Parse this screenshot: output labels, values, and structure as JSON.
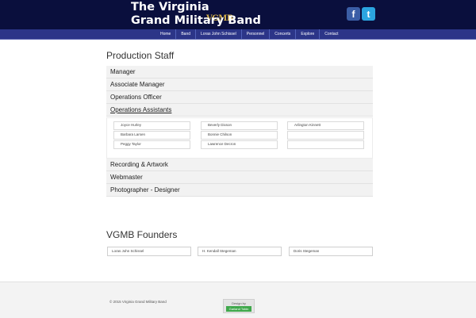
{
  "header": {
    "logo_text": "VGMB",
    "title_line1": "The Virginia",
    "title_line2": "Grand Military Band",
    "facebook_glyph": "f",
    "twitter_glyph": "t"
  },
  "nav": {
    "items": [
      "Home",
      "Band",
      "Loras John Schissel",
      "Personnel",
      "Concerts",
      "Explore",
      "Contact"
    ]
  },
  "production_staff": {
    "title": "Production Staff",
    "roles_top": [
      "Manager",
      "Associate Manager",
      "Operations Officer",
      "Operations Assistants"
    ],
    "assistants": [
      "Joyce Hurley",
      "Beverly Dixson",
      "Arlington Kinnett",
      "Barbara Larsen",
      "Bonnie Chilson",
      "",
      "Peggy Taylor",
      "Lawrence Decron",
      ""
    ],
    "roles_bottom": [
      "Recording & Artwork",
      "Webmaster",
      "Photographer - Designer"
    ]
  },
  "founders": {
    "title": "VGMB Founders",
    "names": [
      "Loras John Schissel",
      "H. Kendall Stegeman",
      "Doris Stegeman"
    ]
  },
  "footer": {
    "copyright": "© 2015 Virginia Grand Military Band",
    "badge_top": "Design by",
    "badge_button": "Garland Tobin"
  },
  "colors": {
    "header_bg": "#0a0f3d",
    "nav_bg": "#2c3588",
    "logo_gold": "#d8b34a",
    "facebook": "#3b5ea6",
    "twitter": "#2ba5e0",
    "badge_green": "#3fa84b"
  }
}
